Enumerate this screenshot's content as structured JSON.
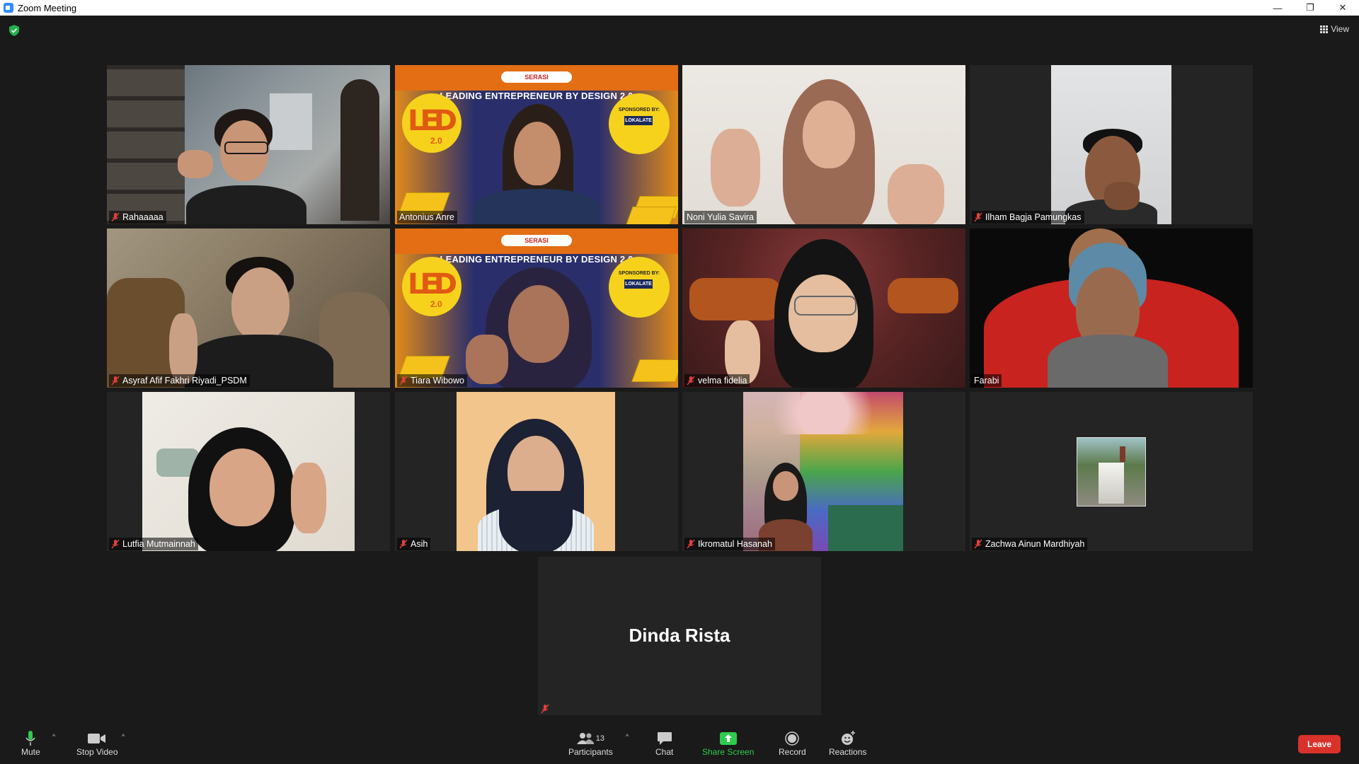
{
  "window": {
    "title": "Zoom Meeting",
    "controls": [
      "—",
      "❐",
      "✕"
    ]
  },
  "top": {
    "view_label": "View"
  },
  "participants": [
    {
      "name": "Rahaaaaa",
      "muted": true
    },
    {
      "name": "Antonius Anre",
      "muted": false,
      "active_speaker": true
    },
    {
      "name": "Noni Yulia Savira",
      "muted": false
    },
    {
      "name": "Ilham Bagja Pamungkas",
      "muted": true
    },
    {
      "name": "Asyraf Afif Fakhri Riyadi_PSDM",
      "muted": true
    },
    {
      "name": "Tiara Wibowo",
      "muted": true
    },
    {
      "name": "velma fidelia",
      "muted": true
    },
    {
      "name": "Farabi",
      "muted": false
    },
    {
      "name": "Lutfia Mutmainnah",
      "muted": true
    },
    {
      "name": "Asih",
      "muted": true
    },
    {
      "name": "Ikromatul Hasanah",
      "muted": true
    },
    {
      "name": "Zachwa Ainun Mardhiyah",
      "muted": true
    },
    {
      "name": "Dinda Rista",
      "muted": true,
      "video_off": true
    }
  ],
  "banner": {
    "logo": "SERASI",
    "title": "LEADING ENTREPRENEUR BY DESIGN 2.0",
    "led": "LED",
    "version": "2.0",
    "sponsor_label": "SPONSORED BY:",
    "sponsor_name": "LOKALATE"
  },
  "toolbar": {
    "mute": "Mute",
    "stop_video": "Stop Video",
    "participants": "Participants",
    "participants_count": "13",
    "chat": "Chat",
    "share_screen": "Share Screen",
    "record": "Record",
    "reactions": "Reactions",
    "leave": "Leave"
  },
  "colors": {
    "active_speaker_border": "#c6d33f",
    "share_green": "#2dcc4d",
    "leave_red": "#d9322b",
    "muted_red": "#e0403a"
  }
}
